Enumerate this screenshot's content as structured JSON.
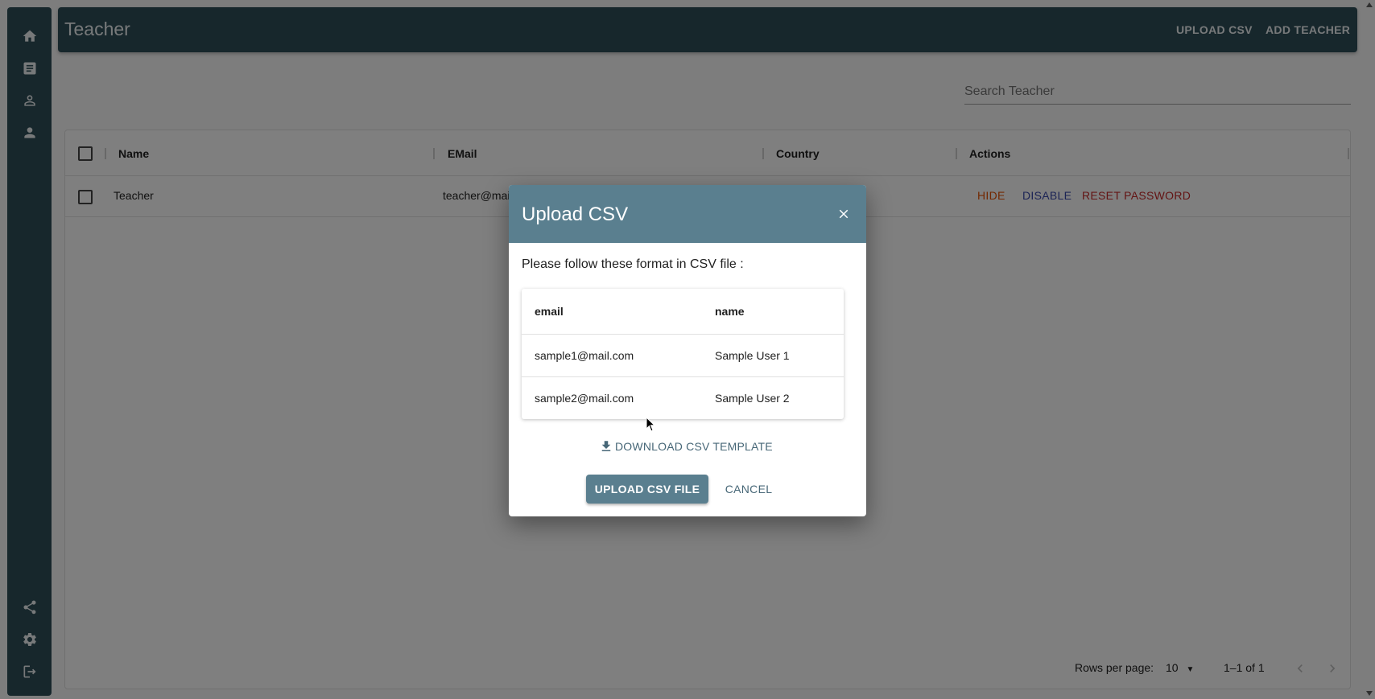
{
  "sidebar": {
    "top_items": [
      {
        "icon": "home-icon"
      },
      {
        "icon": "document-icon"
      },
      {
        "icon": "person-outline-icon"
      },
      {
        "icon": "person-icon"
      }
    ],
    "bottom_items": [
      {
        "icon": "share-icon"
      },
      {
        "icon": "gear-icon"
      },
      {
        "icon": "logout-icon"
      }
    ]
  },
  "header": {
    "title": "Teacher",
    "upload_csv": "UPLOAD CSV",
    "add_teacher": "ADD TEACHER"
  },
  "search": {
    "placeholder": "Search Teacher"
  },
  "table": {
    "columns": [
      "Name",
      "EMail",
      "Country",
      "Actions"
    ],
    "rows": [
      {
        "name": "Teacher",
        "email": "teacher@mai",
        "country": "",
        "actions": {
          "hide": "HIDE",
          "disable": "DISABLE",
          "reset": "RESET PASSWORD"
        }
      }
    ],
    "footer": {
      "rows_per_page_label": "Rows per page:",
      "rows_per_page_value": "10",
      "range": "1–1 of 1"
    }
  },
  "dialog": {
    "title": "Upload CSV",
    "instruction": "Please follow these format in CSV file :",
    "sample": {
      "headers": [
        "email",
        "name"
      ],
      "rows": [
        [
          "sample1@mail.com",
          "Sample User 1"
        ],
        [
          "sample2@mail.com",
          "Sample User 2"
        ]
      ]
    },
    "download_label": "DOWNLOAD CSV TEMPLATE",
    "upload_label": "UPLOAD CSV FILE",
    "cancel_label": "CANCEL"
  },
  "colors": {
    "primary": "#2f4f59",
    "dialog_header": "#5a7f8f",
    "hide_action": "#e65100",
    "disable_action": "#3949ab",
    "reset_action": "#c62828"
  }
}
